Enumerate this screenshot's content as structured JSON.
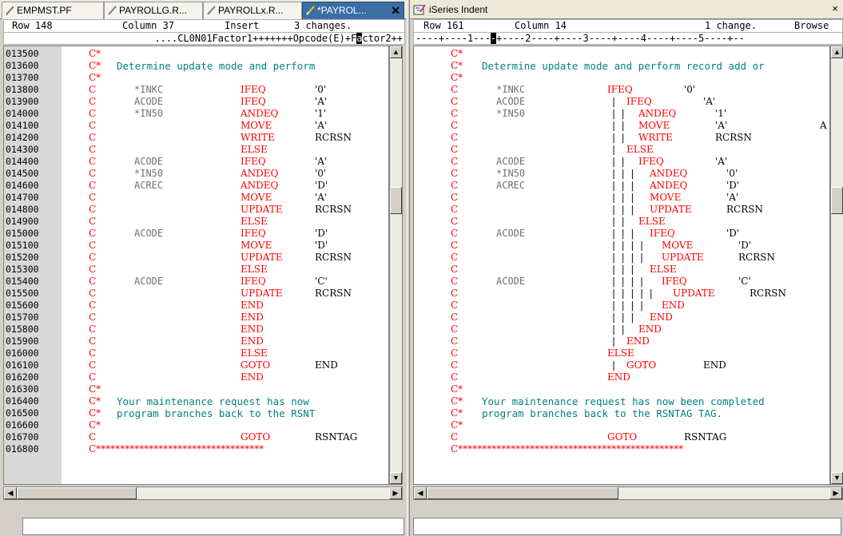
{
  "left_tabs": [
    {
      "label": "EMPMST.PF",
      "active": false
    },
    {
      "label": "PAYROLLG.R...",
      "active": false
    },
    {
      "label": "PAYROLLx.R...",
      "active": false
    },
    {
      "label": "*PAYROL...",
      "active": true
    }
  ],
  "left_status": {
    "row": "Row 148",
    "column": "Column 37",
    "mode": "Insert",
    "changes": "3 changes."
  },
  "left_ruler": {
    "before": "....CL0N01Factor1+++++++Opcode(E)+F",
    "cursor": "a",
    "after": "ctor2++"
  },
  "right_view": {
    "title": "iSeries Indent",
    "close": "×"
  },
  "right_status": {
    "row": "Row 161",
    "column": "Column 14",
    "changes": "1 change.",
    "mode": "Browse"
  },
  "right_ruler": {
    "before": "----+----1---",
    "cursor": "-",
    "after": "+----2----+----3----+----4----+----5----+--"
  },
  "left_lines": [
    {
      "seq": "013500",
      "spec": "C*",
      "f1": "",
      "op": "",
      "f2": "",
      "cmt": ""
    },
    {
      "seq": "013600",
      "spec": "C*",
      "f1": "",
      "op": "",
      "f2": "",
      "cmt": "Determine update mode and perform"
    },
    {
      "seq": "013700",
      "spec": "C*",
      "f1": "",
      "op": "",
      "f2": "",
      "cmt": ""
    },
    {
      "seq": "013800",
      "spec": "C",
      "f1": "*INKC",
      "op": "IFEQ",
      "f2": "'0'",
      "cmt": ""
    },
    {
      "seq": "013900",
      "spec": "C",
      "f1": "ACODE",
      "op": "IFEQ",
      "f2": "'A'",
      "cmt": ""
    },
    {
      "seq": "014000",
      "spec": "C",
      "f1": "*IN50",
      "op": "ANDEQ",
      "f2": "'1'",
      "cmt": ""
    },
    {
      "seq": "014100",
      "spec": "C",
      "f1": "",
      "op": "MOVE",
      "f2": "'A'",
      "cmt": ""
    },
    {
      "seq": "014200",
      "spec": "C",
      "f1": "",
      "op": "WRITE",
      "f2": "RCRSN",
      "cmt": ""
    },
    {
      "seq": "014300",
      "spec": "C",
      "f1": "",
      "op": "ELSE",
      "f2": "",
      "cmt": ""
    },
    {
      "seq": "014400",
      "spec": "C",
      "f1": "ACODE",
      "op": "IFEQ",
      "f2": "'A'",
      "cmt": ""
    },
    {
      "seq": "014500",
      "spec": "C",
      "f1": "*IN50",
      "op": "ANDEQ",
      "f2": "'0'",
      "cmt": ""
    },
    {
      "seq": "014600",
      "spec": "C",
      "f1": "ACREC",
      "op": "ANDEQ",
      "f2": "'D'",
      "cmt": ""
    },
    {
      "seq": "014700",
      "spec": "C",
      "f1": "",
      "op": "MOVE",
      "f2": "'A'",
      "cmt": ""
    },
    {
      "seq": "014800",
      "spec": "C",
      "f1": "",
      "op": "UPDATE",
      "f2": "RCRSN",
      "cmt": ""
    },
    {
      "seq": "014900",
      "spec": "C",
      "f1": "",
      "op": "ELSE",
      "f2": "",
      "cmt": ""
    },
    {
      "seq": "015000",
      "spec": "C",
      "f1": "ACODE",
      "op": "IFEQ",
      "f2": "'D'",
      "cmt": ""
    },
    {
      "seq": "015100",
      "spec": "C",
      "f1": "",
      "op": "MOVE",
      "f2": "'D'",
      "cmt": ""
    },
    {
      "seq": "015200",
      "spec": "C",
      "f1": "",
      "op": "UPDATE",
      "f2": "RCRSN",
      "cmt": ""
    },
    {
      "seq": "015300",
      "spec": "C",
      "f1": "",
      "op": "ELSE",
      "f2": "",
      "cmt": ""
    },
    {
      "seq": "015400",
      "spec": "C",
      "f1": "ACODE",
      "op": "IFEQ",
      "f2": "'C'",
      "cmt": ""
    },
    {
      "seq": "015500",
      "spec": "C",
      "f1": "",
      "op": "UPDATE",
      "f2": "RCRSN",
      "cmt": ""
    },
    {
      "seq": "015600",
      "spec": "C",
      "f1": "",
      "op": "END",
      "f2": "",
      "cmt": ""
    },
    {
      "seq": "015700",
      "spec": "C",
      "f1": "",
      "op": "END",
      "f2": "",
      "cmt": ""
    },
    {
      "seq": "015800",
      "spec": "C",
      "f1": "",
      "op": "END",
      "f2": "",
      "cmt": ""
    },
    {
      "seq": "015900",
      "spec": "C",
      "f1": "",
      "op": "END",
      "f2": "",
      "cmt": ""
    },
    {
      "seq": "016000",
      "spec": "C",
      "f1": "",
      "op": "ELSE",
      "f2": "",
      "cmt": ""
    },
    {
      "seq": "016100",
      "spec": "C",
      "f1": "",
      "op": "GOTO",
      "f2": "END",
      "cmt": ""
    },
    {
      "seq": "016200",
      "spec": "C",
      "f1": "",
      "op": "END",
      "f2": "",
      "cmt": ""
    },
    {
      "seq": "016300",
      "spec": "C*",
      "f1": "",
      "op": "",
      "f2": "",
      "cmt": ""
    },
    {
      "seq": "016400",
      "spec": "C*",
      "f1": "",
      "op": "",
      "f2": "",
      "cmt": "Your maintenance request has now"
    },
    {
      "seq": "016500",
      "spec": "C*",
      "f1": "",
      "op": "",
      "f2": "",
      "cmt": "program branches back to the RSNT"
    },
    {
      "seq": "016600",
      "spec": "C*",
      "f1": "",
      "op": "",
      "f2": "",
      "cmt": ""
    },
    {
      "seq": "016700",
      "spec": "C",
      "f1": "",
      "op": "GOTO",
      "f2": "RSNTAG",
      "cmt": ""
    },
    {
      "seq": "016800",
      "spec": "C***********************************",
      "f1": "",
      "op": "",
      "f2": "",
      "cmt": ""
    }
  ],
  "right_lines": [
    {
      "spec": "C*",
      "f1": "",
      "guides": "",
      "op": "",
      "f2": "",
      "extra": "",
      "cmt": ""
    },
    {
      "spec": "C*",
      "f1": "",
      "guides": "",
      "op": "",
      "f2": "",
      "extra": "",
      "cmt": "Determine update mode and perform record add or"
    },
    {
      "spec": "C*",
      "f1": "",
      "guides": "",
      "op": "",
      "f2": "",
      "extra": "",
      "cmt": ""
    },
    {
      "spec": "C",
      "f1": "*INKC",
      "guides": "",
      "op": "IFEQ",
      "f2": "'0'",
      "extra": "",
      "cmt": ""
    },
    {
      "spec": "C",
      "f1": "ACODE",
      "guides": "|",
      "op": "IFEQ",
      "f2": "'A'",
      "extra": "",
      "cmt": ""
    },
    {
      "spec": "C",
      "f1": "*IN50",
      "guides": "|  |",
      "op": "ANDEQ",
      "f2": "'1'",
      "extra": "",
      "cmt": ""
    },
    {
      "spec": "C",
      "f1": "",
      "guides": "|  |",
      "op": "MOVE",
      "f2": "'A'",
      "extra": "A",
      "cmt": ""
    },
    {
      "spec": "C",
      "f1": "",
      "guides": "|  |",
      "op": "WRITE",
      "f2": "RCRSN",
      "extra": "",
      "cmt": ""
    },
    {
      "spec": "C",
      "f1": "",
      "guides": "|",
      "op": "ELSE",
      "f2": "",
      "extra": "",
      "cmt": ""
    },
    {
      "spec": "C",
      "f1": "ACODE",
      "guides": "|  |",
      "op": "IFEQ",
      "f2": "'A'",
      "extra": "",
      "cmt": ""
    },
    {
      "spec": "C",
      "f1": "*IN50",
      "guides": "|  |  |",
      "op": "ANDEQ",
      "f2": "'0'",
      "extra": "",
      "cmt": ""
    },
    {
      "spec": "C",
      "f1": "ACREC",
      "guides": "|  |  |",
      "op": "ANDEQ",
      "f2": "'D'",
      "extra": "",
      "cmt": ""
    },
    {
      "spec": "C",
      "f1": "",
      "guides": "|  |  |",
      "op": "MOVE",
      "f2": "'A'",
      "extra": "",
      "cmt": ""
    },
    {
      "spec": "C",
      "f1": "",
      "guides": "|  |  |",
      "op": "UPDATE",
      "f2": "RCRSN",
      "extra": "",
      "cmt": ""
    },
    {
      "spec": "C",
      "f1": "",
      "guides": "|  |",
      "op": "ELSE",
      "f2": "",
      "extra": "",
      "cmt": ""
    },
    {
      "spec": "C",
      "f1": "ACODE",
      "guides": "|  |  |",
      "op": "IFEQ",
      "f2": "'D'",
      "extra": "",
      "cmt": ""
    },
    {
      "spec": "C",
      "f1": "",
      "guides": "|  |  |  |",
      "op": "MOVE",
      "f2": "'D'",
      "extra": "",
      "cmt": ""
    },
    {
      "spec": "C",
      "f1": "",
      "guides": "|  |  |  |",
      "op": "UPDATE",
      "f2": "RCRSN",
      "extra": "",
      "cmt": ""
    },
    {
      "spec": "C",
      "f1": "",
      "guides": "|  |  |",
      "op": "ELSE",
      "f2": "",
      "extra": "",
      "cmt": ""
    },
    {
      "spec": "C",
      "f1": "ACODE",
      "guides": "|  |  |  |",
      "op": "IFEQ",
      "f2": "'C'",
      "extra": "",
      "cmt": ""
    },
    {
      "spec": "C",
      "f1": "",
      "guides": "|  |  |  |  |",
      "op": "UPDATE",
      "f2": "RCRSN",
      "extra": "",
      "cmt": ""
    },
    {
      "spec": "C",
      "f1": "",
      "guides": "|  |  |  |",
      "op": "END",
      "f2": "",
      "extra": "",
      "cmt": ""
    },
    {
      "spec": "C",
      "f1": "",
      "guides": "|  |  |",
      "op": "END",
      "f2": "",
      "extra": "",
      "cmt": ""
    },
    {
      "spec": "C",
      "f1": "",
      "guides": "|  |",
      "op": "END",
      "f2": "",
      "extra": "",
      "cmt": ""
    },
    {
      "spec": "C",
      "f1": "",
      "guides": "|",
      "op": "END",
      "f2": "",
      "extra": "",
      "cmt": ""
    },
    {
      "spec": "C",
      "f1": "",
      "guides": "",
      "op": "ELSE",
      "f2": "",
      "extra": "",
      "cmt": ""
    },
    {
      "spec": "C",
      "f1": "",
      "guides": "|",
      "op": "GOTO",
      "f2": "END",
      "extra": "",
      "cmt": ""
    },
    {
      "spec": "C",
      "f1": "",
      "guides": "",
      "op": "END",
      "f2": "",
      "extra": "",
      "cmt": ""
    },
    {
      "spec": "C*",
      "f1": "",
      "guides": "",
      "op": "",
      "f2": "",
      "extra": "",
      "cmt": ""
    },
    {
      "spec": "C*",
      "f1": "",
      "guides": "",
      "op": "",
      "f2": "",
      "extra": "",
      "cmt": "Your maintenance request has now been completed"
    },
    {
      "spec": "C*",
      "f1": "",
      "guides": "",
      "op": "",
      "f2": "",
      "extra": "",
      "cmt": "program branches back to the RSNTAG TAG."
    },
    {
      "spec": "C*",
      "f1": "",
      "guides": "",
      "op": "",
      "f2": "",
      "extra": "",
      "cmt": ""
    },
    {
      "spec": "C",
      "f1": "",
      "guides": "",
      "op": "GOTO",
      "f2": "RSNTAG",
      "extra": "",
      "cmt": ""
    },
    {
      "spec": "C***********************************************",
      "f1": "",
      "guides": "",
      "op": "",
      "f2": "",
      "extra": "",
      "cmt": ""
    }
  ],
  "icons": {
    "tab_file": "pencil-file-icon",
    "view": "indent-view-icon"
  },
  "colors": {
    "spec": "#ff0000",
    "opcode": "#ff0000",
    "comment": "#008080",
    "factor1": "#707070",
    "active_tab": "#3a6ea5"
  }
}
